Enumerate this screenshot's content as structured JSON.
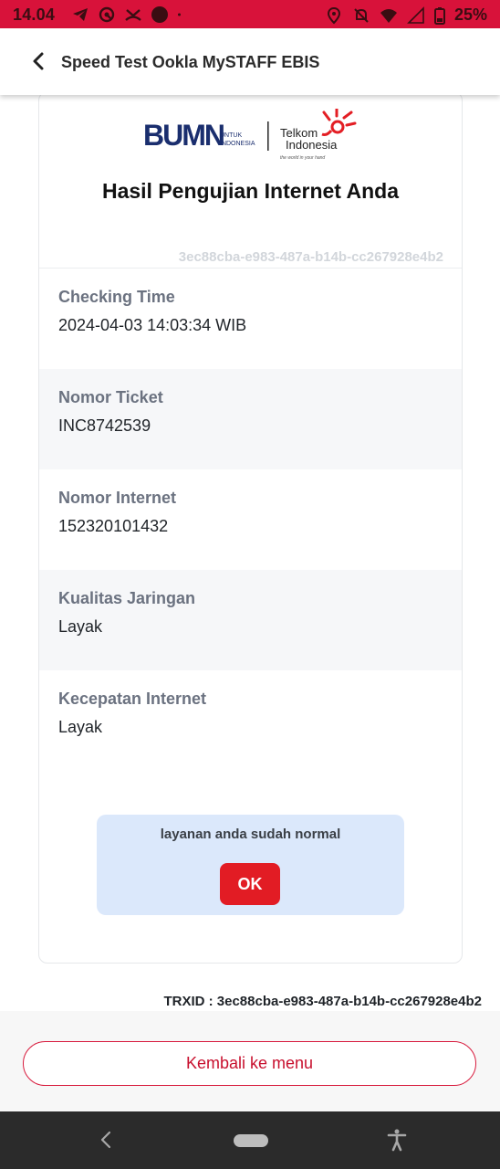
{
  "status_bar": {
    "time": "14.04",
    "battery": "25%",
    "icons_left": [
      "telegram-icon",
      "radar-icon",
      "missed-call-icon",
      "app-icon",
      "dot-icon"
    ],
    "icons_right": [
      "location-icon",
      "mute-icon",
      "wifi-icon",
      "signal-icon",
      "battery-icon"
    ],
    "color": "#d8123a"
  },
  "app_bar": {
    "title": "Speed Test Ookla MySTAFF EBIS",
    "back_icon": "chevron-left-icon"
  },
  "logos": {
    "left": "BUMN",
    "left_sub_top": "UNTUK",
    "left_sub_bottom": "INDONESIA",
    "right_top": "Telkom",
    "right_bottom": "Indonesia",
    "right_tagline": "the world in your hand"
  },
  "card": {
    "title": "Hasil Pengujian Internet Anda",
    "uuid": "3ec88cba-e983-487a-b14b-cc267928e4b2"
  },
  "rows": [
    {
      "label": "Checking Time",
      "value": "2024-04-03 14:03:34 WIB"
    },
    {
      "label": "Nomor Ticket",
      "value": "INC8742539"
    },
    {
      "label": "Nomor Internet",
      "value": "152320101432"
    },
    {
      "label": "Kualitas Jaringan",
      "value": "Layak"
    },
    {
      "label": "Kecepatan Internet",
      "value": "Layak"
    }
  ],
  "notice": {
    "text": "layanan anda sudah normal",
    "ok_label": "OK",
    "background": "#dbe8fb",
    "ok_color": "#e21c24"
  },
  "trxid": "TRXID : 3ec88cba-e983-487a-b14b-cc267928e4b2",
  "bottom": {
    "menu_button_label": "Kembali ke menu",
    "accent": "#c8102e"
  },
  "nav_bar": {
    "icons": [
      "back-icon",
      "home-pill-icon",
      "accessibility-icon"
    ]
  }
}
